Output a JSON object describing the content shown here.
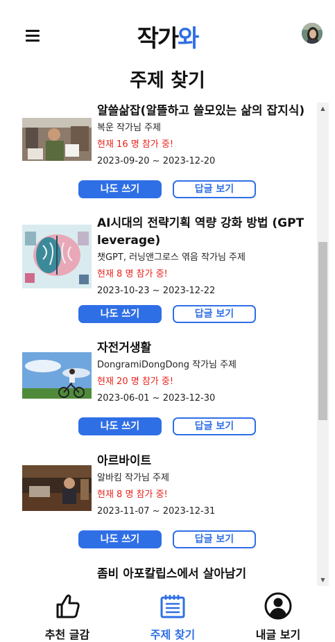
{
  "header": {
    "logo_part1": "작가",
    "logo_part2": "와"
  },
  "page_title": "주제 찾기",
  "topics": [
    {
      "title": "알쓸삶잡(알뜰하고 쓸모있는 삶의 잡지식)",
      "author": "복운 작가님 주제",
      "participants": "현재 16 명 참가 중!",
      "dates": "2023-09-20 ~ 2023-12-20",
      "write_label": "나도 쓰기",
      "answer_label": "답글 보기"
    },
    {
      "title": "AI시대의 전략기획 역량 강화 방법 (GPT leverage)",
      "author": "챗GPT, 러닝앤그로스 엮음 작가님 주제",
      "participants": "현재 8 명 참가 중!",
      "dates": "2023-10-23 ~ 2023-12-22",
      "write_label": "나도 쓰기",
      "answer_label": "답글 보기"
    },
    {
      "title": "자전거생활",
      "author": "DongramiDongDong 작가님 주제",
      "participants": "현재 20 명 참가 중!",
      "dates": "2023-06-01 ~ 2023-12-30",
      "write_label": "나도 쓰기",
      "answer_label": "답글 보기"
    },
    {
      "title": "아르바이트",
      "author": "알바킴 작가님 주제",
      "participants": "현재 8 명 참가 중!",
      "dates": "2023-11-07 ~ 2023-12-31",
      "write_label": "나도 쓰기",
      "answer_label": "답글 보기"
    },
    {
      "title": "좀비 아포칼립스에서 살아남기"
    }
  ],
  "bottom_nav": [
    {
      "label": "추천 글감",
      "icon": "thumbs-up-icon"
    },
    {
      "label": "주제 찾기",
      "icon": "notepad-icon",
      "active": true
    },
    {
      "label": "내글 보기",
      "icon": "user-circle-icon"
    }
  ],
  "colors": {
    "accent": "#2f6fe6",
    "alert": "#e8221c"
  }
}
